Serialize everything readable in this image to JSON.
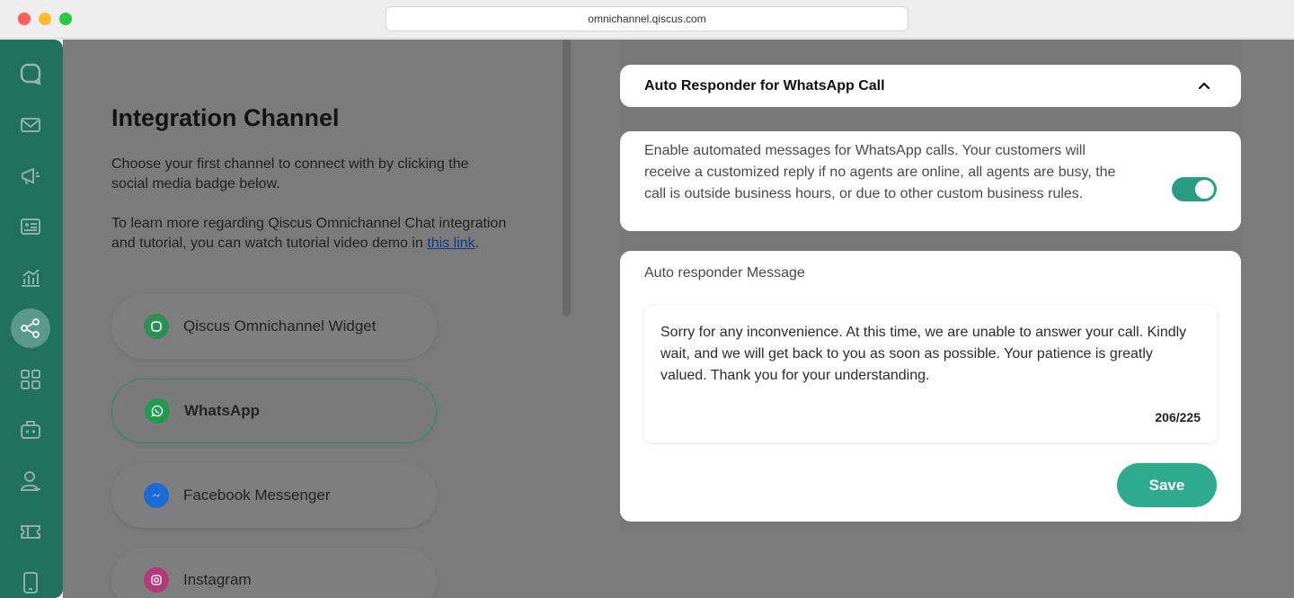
{
  "browser": {
    "url": "omnichannel.qiscus.com"
  },
  "sidebar": {
    "items": [
      {
        "icon": "chat-bubble-icon"
      },
      {
        "icon": "mail-icon"
      },
      {
        "icon": "megaphone-icon"
      },
      {
        "icon": "contact-card-icon"
      },
      {
        "icon": "analytics-icon"
      },
      {
        "icon": "share-icon",
        "active": true
      },
      {
        "icon": "apps-grid-icon"
      },
      {
        "icon": "bot-icon"
      },
      {
        "icon": "user-icon"
      },
      {
        "icon": "ticket-icon"
      },
      {
        "icon": "mobile-icon"
      }
    ]
  },
  "integration": {
    "title": "Integration Channel",
    "desc1": "Choose your first channel to connect with by clicking the social media badge below.",
    "desc2_prefix": "To learn more regarding Qiscus Omnichannel Chat integration and tutorial, you can watch tutorial video demo in",
    "link": "this link",
    "desc2_suffix": ".",
    "channels": [
      {
        "label": "Qiscus Omnichannel Widget",
        "icon": "qiscus-icon",
        "color": "#2f8d57"
      },
      {
        "label": "WhatsApp",
        "icon": "whatsapp-icon",
        "color": "#1f9a4e",
        "selected": true
      },
      {
        "label": "Facebook Messenger",
        "icon": "messenger-icon",
        "color": "#1a6bd6"
      },
      {
        "label": "Instagram",
        "icon": "instagram-icon",
        "color": "#b13a7a"
      }
    ]
  },
  "auto_responder": {
    "header": "Auto Responder for WhatsApp Call",
    "toggle_desc": "Enable automated messages for WhatsApp calls. Your customers will receive a customized reply if no agents are online, all agents are busy, the call is outside business hours, or due to other custom business rules.",
    "toggle_on": true,
    "message_label": "Auto responder Message",
    "message": "Sorry for any inconvenience. At this time, we are unable to answer your call. Kindly wait, and we will get back to you as soon as possible. Your patience is greatly valued. Thank you for your understanding.",
    "counter": "206/225",
    "save_label": "Save"
  },
  "colors": {
    "primary": "#2eab8c",
    "sidebar": "#21715f",
    "toggle": "#2b9c84"
  }
}
